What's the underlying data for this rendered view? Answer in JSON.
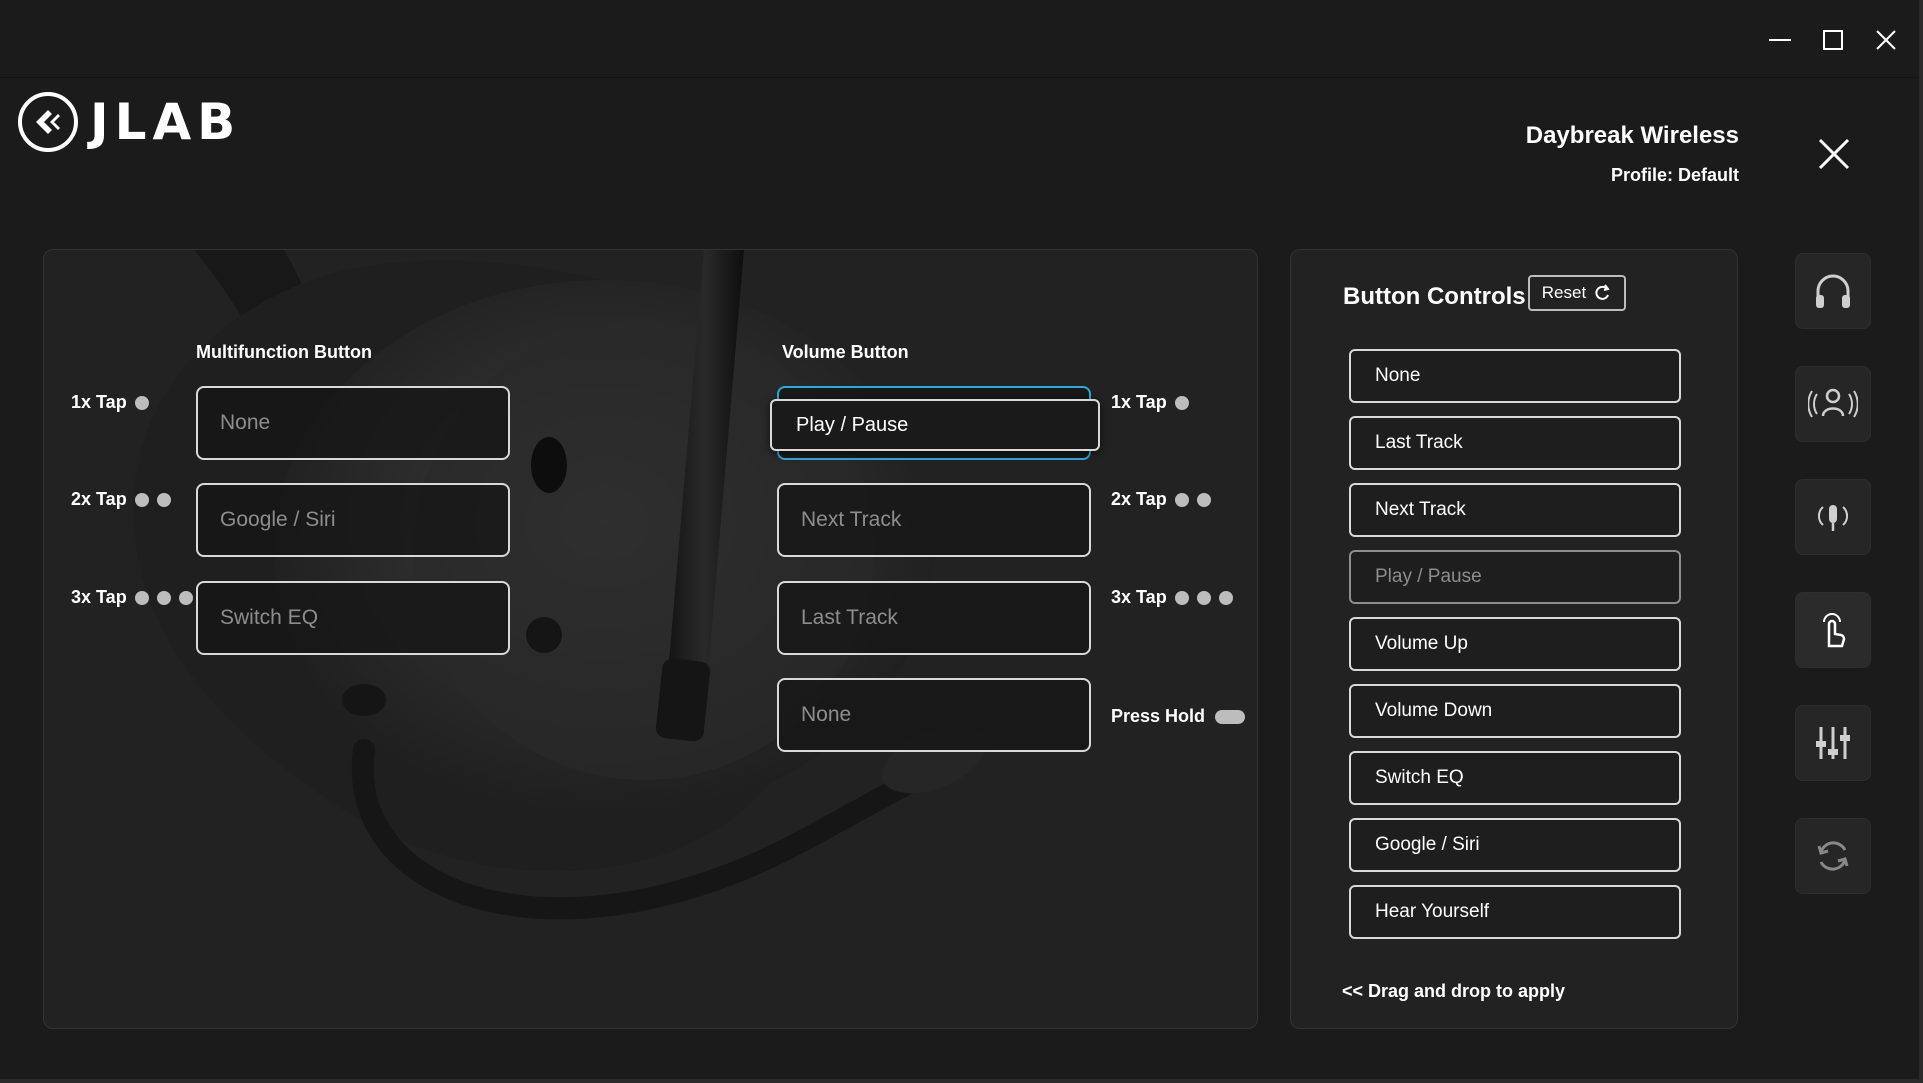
{
  "window": {
    "minimize_icon": "minimize-icon",
    "maximize_icon": "maximize-icon",
    "close_icon": "close-icon"
  },
  "header": {
    "logo_text": "JLAB",
    "device_name": "Daybreak Wireless",
    "profile_label": "Profile:",
    "profile_value": "Default"
  },
  "multifunction": {
    "title": "Multifunction Button",
    "rows": [
      {
        "tap": "1x Tap",
        "dots": 1,
        "value": "None"
      },
      {
        "tap": "2x Tap",
        "dots": 2,
        "value": "Google / Siri"
      },
      {
        "tap": "3x Tap",
        "dots": 3,
        "value": "Switch EQ"
      }
    ]
  },
  "volume": {
    "title": "Volume Button",
    "rows": [
      {
        "tap": "1x Tap",
        "dots": 1,
        "value": "Play / Pause"
      },
      {
        "tap": "2x Tap",
        "dots": 2,
        "value": "Next Track"
      },
      {
        "tap": "3x Tap",
        "dots": 3,
        "value": "Last Track"
      },
      {
        "tap": "Press Hold",
        "value": "None"
      }
    ],
    "dragging_value": "Play / Pause"
  },
  "button_controls": {
    "title": "Button Controls",
    "reset_label": "Reset",
    "items": [
      "None",
      "Last Track",
      "Next Track",
      "Play / Pause",
      "Volume Up",
      "Volume Down",
      "Switch EQ",
      "Google / Siri",
      "Hear Yourself"
    ],
    "disabled_item": "Play / Pause",
    "hint": "<< Drag and drop to apply"
  },
  "side_nav": [
    "headphones-icon",
    "noise-control-icon",
    "microphone-icon",
    "touch-gesture-icon",
    "equalizer-icon",
    "update-icon"
  ],
  "colors": {
    "background": "#1b1b1b",
    "panel": "#222222",
    "accent": "#2fa9d8",
    "border": "#d9d9d9",
    "muted_text": "#8d8d8d"
  }
}
